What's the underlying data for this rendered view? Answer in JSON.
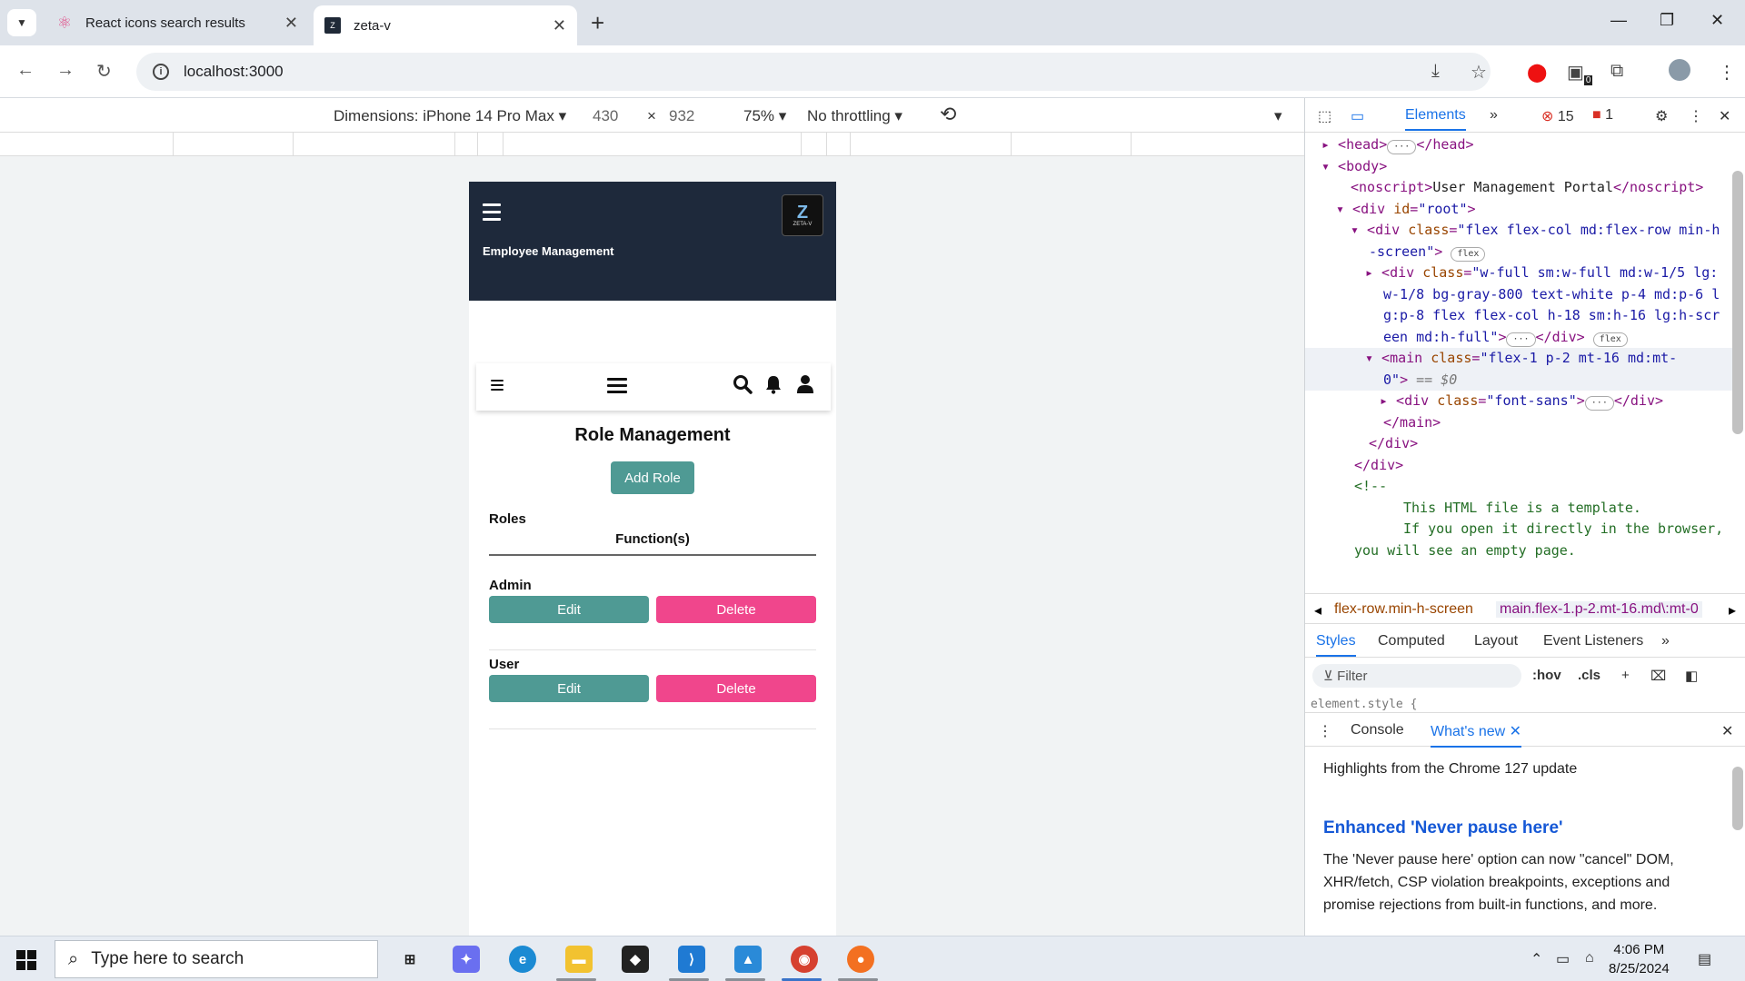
{
  "browser": {
    "tabs": [
      {
        "title": "React icons search results",
        "active": false
      },
      {
        "title": "zeta-v",
        "active": true
      }
    ],
    "url": "localhost:3000",
    "extension_badge": "0"
  },
  "device_toolbar": {
    "dimensions_label": "Dimensions: iPhone 14 Pro Max",
    "width": "430",
    "times": "×",
    "height": "932",
    "zoom": "75%",
    "throttling": "No throttling"
  },
  "app": {
    "brand": "Employee Management",
    "logo_big": "Z",
    "logo_small": "ZETA-V",
    "page_title": "Role Management",
    "add_role_label": "Add Role",
    "col_roles": "Roles",
    "col_functions": "Function(s)",
    "roles": [
      {
        "name": "Admin",
        "edit_label": "Edit",
        "delete_label": "Delete"
      },
      {
        "name": "User",
        "edit_label": "Edit",
        "delete_label": "Delete"
      }
    ],
    "colors": {
      "header": "#1e293b",
      "edit": "#4f9a94",
      "delete": "#f0468c"
    }
  },
  "devtools": {
    "tab_elements": "Elements",
    "error_count": "15",
    "warning_count": "1",
    "crumb_1": "flex-row.min-h-screen",
    "crumb_2": "main.flex-1.p-2.mt-16.md\\:mt-0",
    "styles_tabs": [
      "Styles",
      "Computed",
      "Layout",
      "Event Listeners"
    ],
    "filter_placeholder": "Filter",
    "hov": ":hov",
    "cls": ".cls",
    "element_style": "element.style {",
    "drawer_console": "Console",
    "drawer_whatsnew": "What's new",
    "whatsnew_intro": "Highlights from the Chrome 127 update",
    "whatsnew_heading": "Enhanced 'Never pause here'",
    "whatsnew_body": "The 'Never pause here' option can now \"cancel\" DOM, XHR/fetch, CSP violation breakpoints, exceptions and promise rejections from built-in functions, and more."
  },
  "taskbar": {
    "search_placeholder": "Type here to search",
    "time": "4:06 PM",
    "date": "8/25/2024"
  }
}
